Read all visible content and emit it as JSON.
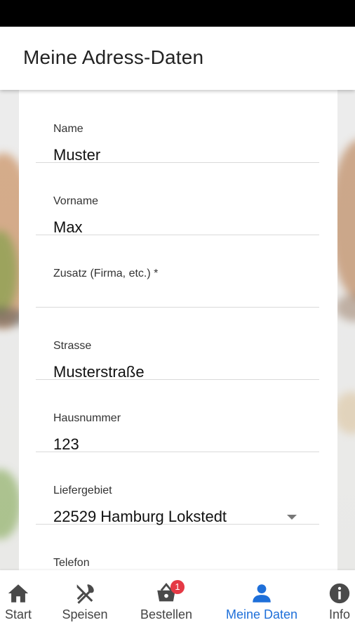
{
  "header": {
    "title": "Meine Adress-Daten"
  },
  "form": {
    "fields": [
      {
        "label": "Name",
        "value": "Muster"
      },
      {
        "label": "Vorname",
        "value": "Max"
      },
      {
        "label": "Zusatz (Firma, etc.) *",
        "value": ""
      },
      {
        "label": "Strasse",
        "value": "Musterstraße"
      },
      {
        "label": "Hausnummer",
        "value": "123"
      },
      {
        "label": "Liefergebiet",
        "value": "22529 Hamburg Lokstedt"
      },
      {
        "label": "Telefon",
        "value": ""
      }
    ]
  },
  "nav": {
    "items": [
      {
        "label": "Start",
        "icon": "home-icon"
      },
      {
        "label": "Speisen",
        "icon": "cutlery-icon"
      },
      {
        "label": "Bestellen",
        "icon": "basket-icon",
        "badge": "1"
      },
      {
        "label": "Meine Daten",
        "icon": "person-icon"
      },
      {
        "label": "Info",
        "icon": "info-icon"
      }
    ],
    "active_color": "#1e6fd9",
    "badge_color": "#e53945"
  }
}
